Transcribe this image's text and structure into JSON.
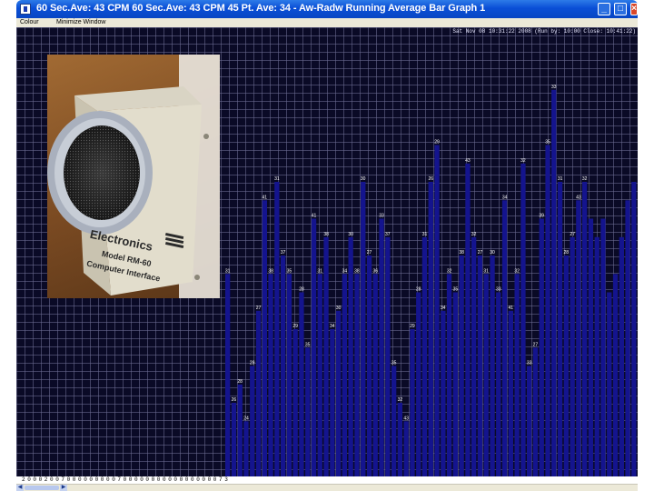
{
  "window": {
    "title": "60 Sec.Ave: 43 CPM 60 Sec.Ave: 43 CPM  45 Pt. Ave: 34 - Aw-Radw Running Average Bar Graph 1",
    "min_label": "_",
    "max_label": "□",
    "close_label": "×"
  },
  "menu": {
    "items": [
      "Colour",
      "Minimize Window"
    ]
  },
  "plot": {
    "status_text": "Sat Nov 08 10:31:22 2008 (Run by: 10:00 Close: 10:41:22)",
    "background_color": "#0a0a26",
    "grid_color": "#6e6e96",
    "bar_color": "#14148e",
    "label_color": "#ffffff"
  },
  "photo": {
    "brand_text": "Electronics",
    "model_text": "Model RM-60",
    "subtitle_text": "Computer Interface"
  },
  "chart_data": {
    "type": "bar",
    "values": [
      31,
      24,
      25,
      23,
      26,
      29,
      35,
      31,
      36,
      32,
      31,
      28,
      30,
      27,
      34,
      31,
      33,
      28,
      29,
      31,
      33,
      31,
      36,
      32,
      31,
      34,
      33,
      26,
      24,
      23,
      28,
      30,
      33,
      36,
      38,
      29,
      31,
      30,
      32,
      37,
      33,
      32,
      31,
      32,
      30,
      35,
      29,
      31,
      37,
      26,
      27,
      34,
      38,
      41,
      36,
      32,
      33,
      35,
      36,
      34,
      33,
      34,
      30,
      31,
      33,
      35,
      36
    ],
    "bar_labels": [
      "31",
      "26",
      "28",
      "24",
      "29",
      "27",
      "41",
      "38",
      "31",
      "37",
      "35",
      "29",
      "28",
      "35",
      "41",
      "31",
      "38",
      "34",
      "30",
      "34",
      "30",
      "38",
      "30",
      "27",
      "36",
      "33",
      "37",
      "35",
      "32",
      "43",
      "29",
      "28",
      "31",
      "26",
      "29",
      "34",
      "32",
      "35",
      "38",
      "43",
      "32",
      "27",
      "31",
      "30",
      "33",
      "34",
      "41",
      "32",
      "32",
      "33",
      "27",
      "39",
      "35",
      "33",
      "31",
      "28",
      "27",
      "43",
      "32"
    ],
    "ylim": [
      20,
      44
    ]
  },
  "xaxis": {
    "labels": [
      "2",
      "0",
      "0",
      "0",
      "2",
      "0",
      "0",
      "7",
      "0",
      "0",
      "0",
      "0",
      "0",
      "0",
      "0",
      "0",
      "0",
      "7",
      "0",
      "0",
      "0",
      "0",
      "0",
      "0",
      "0",
      "0",
      "0",
      "0",
      "0",
      "0",
      "0",
      "0",
      "0",
      "0",
      "0",
      "7",
      "3"
    ]
  },
  "scrollbar": {
    "left_arrow": "◀",
    "right_arrow": "▶"
  }
}
